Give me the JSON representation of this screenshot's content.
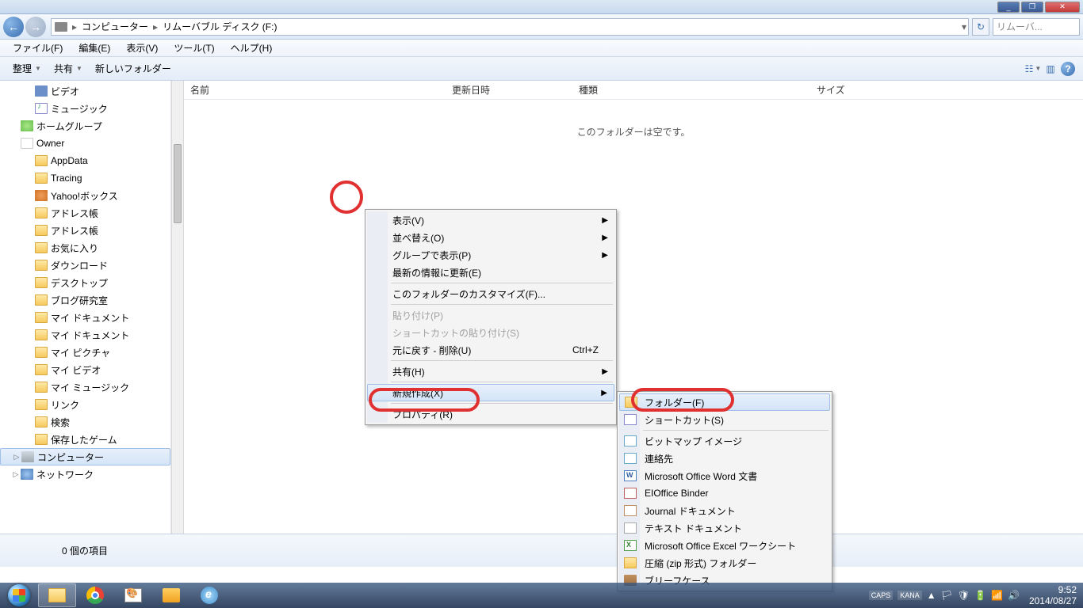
{
  "titlebar": {
    "min": "_",
    "max": "❐",
    "close": "✕"
  },
  "nav": {
    "back": "←",
    "fwd": "→",
    "crumbs": [
      "コンピューター",
      "リムーバブル ディスク (F:)"
    ],
    "sep": "▸",
    "dd": "▾",
    "refresh": "↻",
    "search_placeholder": "リムーバ..."
  },
  "menubar": [
    "ファイル(F)",
    "編集(E)",
    "表示(V)",
    "ツール(T)",
    "ヘルプ(H)"
  ],
  "toolbar": {
    "organize": "整理",
    "share": "共有",
    "newfolder": "新しいフォルダー",
    "view_icon": "☷",
    "pane_icon": "▥",
    "help": "?"
  },
  "sidebar": [
    {
      "indent": 28,
      "icon": "ic-video",
      "label": "ビデオ"
    },
    {
      "indent": 28,
      "icon": "ic-music",
      "label": "ミュージック"
    },
    {
      "indent": 10,
      "icon": "ic-homegroup",
      "label": "ホームグループ"
    },
    {
      "indent": 10,
      "icon": "ic-user",
      "label": "Owner"
    },
    {
      "indent": 28,
      "icon": "ic-folder",
      "label": "AppData"
    },
    {
      "indent": 28,
      "icon": "ic-folder",
      "label": "Tracing"
    },
    {
      "indent": 28,
      "icon": "ic-yahoo",
      "label": "Yahoo!ボックス"
    },
    {
      "indent": 28,
      "icon": "ic-folder-sp",
      "label": "アドレス帳"
    },
    {
      "indent": 28,
      "icon": "ic-folder",
      "label": "アドレス帳"
    },
    {
      "indent": 28,
      "icon": "ic-folder-sp",
      "label": "お気に入り"
    },
    {
      "indent": 28,
      "icon": "ic-folder-sp",
      "label": "ダウンロード"
    },
    {
      "indent": 28,
      "icon": "ic-folder-sp",
      "label": "デスクトップ"
    },
    {
      "indent": 28,
      "icon": "ic-folder",
      "label": "ブログ研究室"
    },
    {
      "indent": 28,
      "icon": "ic-folder-sp",
      "label": "マイ ドキュメント"
    },
    {
      "indent": 28,
      "icon": "ic-folder",
      "label": "マイ ドキュメント"
    },
    {
      "indent": 28,
      "icon": "ic-folder-sp",
      "label": "マイ ピクチャ"
    },
    {
      "indent": 28,
      "icon": "ic-folder-sp",
      "label": "マイ ビデオ"
    },
    {
      "indent": 28,
      "icon": "ic-folder-sp",
      "label": "マイ ミュージック"
    },
    {
      "indent": 28,
      "icon": "ic-folder-sp",
      "label": "リンク"
    },
    {
      "indent": 28,
      "icon": "ic-folder-sp",
      "label": "検索"
    },
    {
      "indent": 28,
      "icon": "ic-folder-sp",
      "label": "保存したゲーム"
    },
    {
      "indent": 10,
      "icon": "ic-computer",
      "label": "コンピューター",
      "selected": true,
      "expander": "▷"
    },
    {
      "indent": 10,
      "icon": "ic-network",
      "label": "ネットワーク",
      "expander": "▷"
    }
  ],
  "columns": {
    "name": "名前",
    "modified": "更新日時",
    "type": "種類",
    "size": "サイズ"
  },
  "empty_msg": "このフォルダーは空です。",
  "status": {
    "count": "0 個の項目"
  },
  "ctx1": {
    "view": "表示(V)",
    "sort": "並べ替え(O)",
    "group": "グループで表示(P)",
    "refresh": "最新の情報に更新(E)",
    "customize": "このフォルダーのカスタマイズ(F)...",
    "paste": "貼り付け(P)",
    "paste_sc": "ショートカットの貼り付け(S)",
    "undo": "元に戻す - 削除(U)",
    "undo_key": "Ctrl+Z",
    "share": "共有(H)",
    "new": "新規作成(X)",
    "props": "プロパティ(R)"
  },
  "ctx2": [
    {
      "icon": "mic-folder",
      "label": "フォルダー(F)",
      "hl": true
    },
    {
      "icon": "mic-shortcut",
      "label": "ショートカット(S)"
    },
    {
      "sep": true
    },
    {
      "icon": "mic-bmp",
      "label": "ビットマップ イメージ"
    },
    {
      "icon": "mic-contact",
      "label": "連絡先"
    },
    {
      "icon": "mic-word",
      "label": "Microsoft Office Word 文書"
    },
    {
      "icon": "mic-binder",
      "label": "EIOffice Binder"
    },
    {
      "icon": "mic-journal",
      "label": "Journal ドキュメント"
    },
    {
      "icon": "mic-txt",
      "label": "テキスト ドキュメント"
    },
    {
      "icon": "mic-excel",
      "label": "Microsoft Office Excel ワークシート"
    },
    {
      "icon": "mic-zip",
      "label": "圧縮 (zip 形式) フォルダー"
    },
    {
      "icon": "mic-brief",
      "label": "ブリーフケース"
    }
  ],
  "tray": {
    "caps": "CAPS",
    "kana": "KANA",
    "up": "▲",
    "time": "9:52",
    "date": "2014/08/27"
  }
}
